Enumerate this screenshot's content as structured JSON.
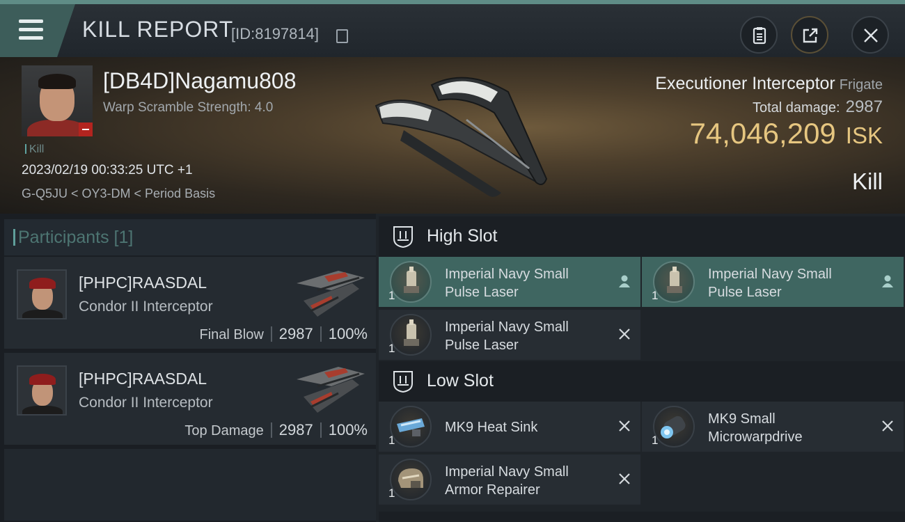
{
  "header": {
    "title": "KILL REPORT",
    "report_id": "[ID:8197814]",
    "icons": [
      "menu-icon",
      "copy-icon",
      "clipboard-icon",
      "share-icon",
      "close-icon"
    ]
  },
  "victim": {
    "name": "[DB4D]Nagamu808",
    "warp_scramble": "Warp Scramble Strength: 4.0",
    "kill_tag": "Kill",
    "datetime": "2023/02/19 00:33:25 UTC +1",
    "location": "G-Q5JU < OY3-DM < Period Basis"
  },
  "ship": {
    "name": "Executioner Interceptor",
    "class": "Frigate",
    "total_damage_label": "Total damage:",
    "total_damage": "2987",
    "isk_amount": "74,046,209",
    "isk_unit": "ISK",
    "result": "Kill"
  },
  "participants": {
    "title": "Participants [1]",
    "rows": [
      {
        "name": "[PHPC]RAASDAL",
        "ship": "Condor II Interceptor",
        "label": "Final Blow",
        "damage": "2987",
        "percent": "100%"
      },
      {
        "name": "[PHPC]RAASDAL",
        "ship": "Condor II Interceptor",
        "label": "Top Damage",
        "damage": "2987",
        "percent": "100%"
      }
    ]
  },
  "high_slot": {
    "title": "High Slot",
    "modules": [
      {
        "name": "Imperial Navy Small Pulse Laser",
        "qty": "1",
        "status": "fitted"
      },
      {
        "name": "Imperial Navy Small Pulse Laser",
        "qty": "1",
        "status": "fitted"
      },
      {
        "name": "Imperial Navy Small Pulse Laser",
        "qty": "1",
        "status": "destroyed"
      }
    ]
  },
  "low_slot": {
    "title": "Low Slot",
    "modules": [
      {
        "name": "MK9 Heat Sink",
        "qty": "1",
        "status": "destroyed"
      },
      {
        "name": "MK9 Small Microwarpdrive",
        "qty": "1",
        "status": "destroyed"
      },
      {
        "name": "Imperial Navy Small Armor Repairer",
        "qty": "1",
        "status": "destroyed"
      }
    ]
  },
  "colors": {
    "accent_teal": "#5f8c86",
    "isk_gold": "#e6c680",
    "fitted_slot": "#3f6661"
  }
}
